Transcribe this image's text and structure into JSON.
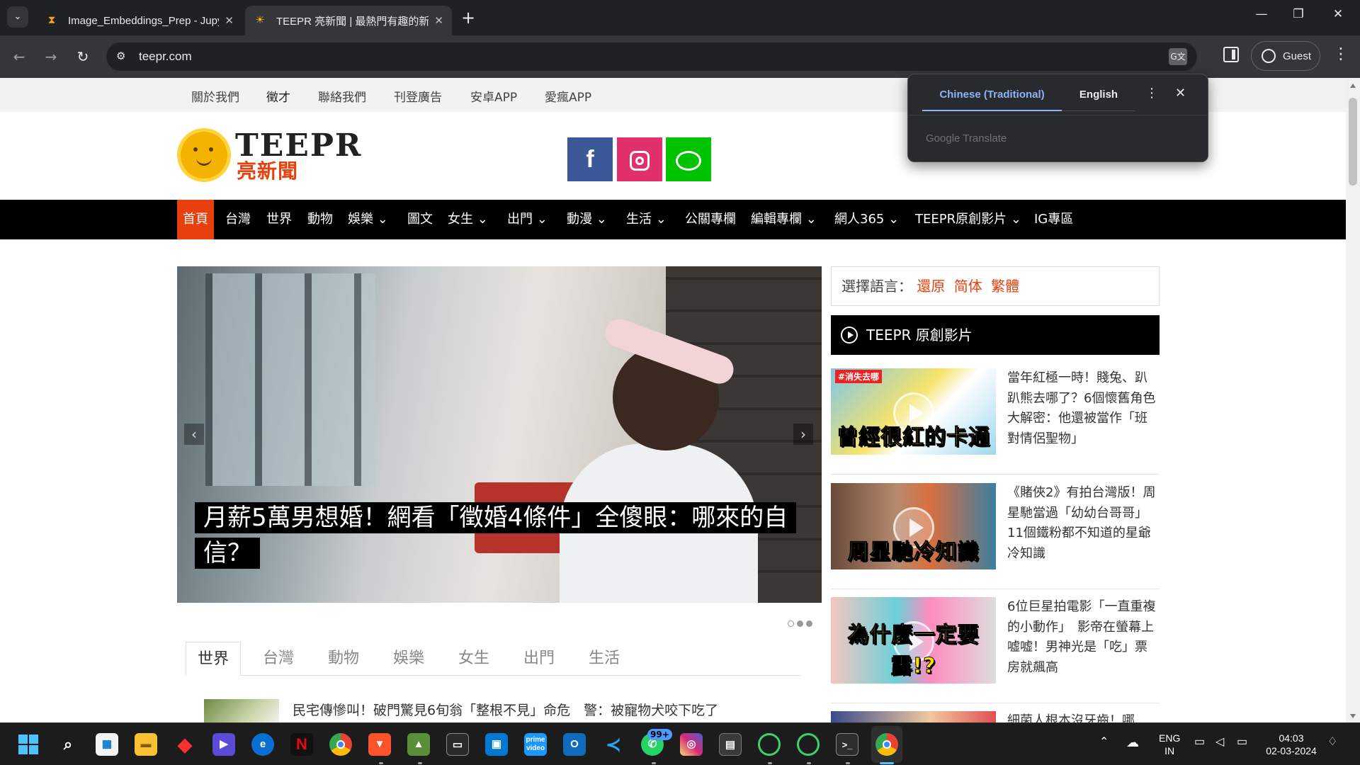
{
  "browser": {
    "tabs": [
      {
        "title": "Image_Embeddings_Prep - Jupyter",
        "active": false
      },
      {
        "title": "TEEPR 亮新聞 | 最熱門有趣的新聞",
        "active": true
      }
    ],
    "url": "teepr.com",
    "profile_label": "Guest"
  },
  "translate_popup": {
    "tab_active": "Chinese (Traditional)",
    "tab_other": "English",
    "brand": "Google Translate"
  },
  "site": {
    "top_links": [
      "關於我們",
      "徵才",
      "聯絡我們",
      "刊登廣告",
      "安卓APP",
      "愛瘋APP"
    ],
    "logo_text": "TEEPR",
    "logo_sub": "亮新聞",
    "social": {
      "facebook": "f"
    },
    "nav": [
      {
        "label": "首頁",
        "dropdown": false,
        "active": true
      },
      {
        "label": "台灣",
        "dropdown": false
      },
      {
        "label": "世界",
        "dropdown": false
      },
      {
        "label": "動物",
        "dropdown": false
      },
      {
        "label": "娛樂",
        "dropdown": true
      },
      {
        "label": "圖文",
        "dropdown": false
      },
      {
        "label": "女生",
        "dropdown": true
      },
      {
        "label": "出門",
        "dropdown": true
      },
      {
        "label": "動漫",
        "dropdown": true
      },
      {
        "label": "生活",
        "dropdown": true
      },
      {
        "label": "公關專欄",
        "dropdown": false
      },
      {
        "label": "編輯專欄",
        "dropdown": true
      },
      {
        "label": "網人365",
        "dropdown": true
      },
      {
        "label": "TEEPR原創影片",
        "dropdown": true
      },
      {
        "label": "IG專區",
        "dropdown": false
      }
    ],
    "slider": {
      "caption": "月薪5萬男想婚！網看「徵婚4條件」全傻眼：哪來的自信？",
      "slide_count": 3,
      "active_slide": 1
    },
    "category_tabs": [
      "世界",
      "台灣",
      "動物",
      "娛樂",
      "女生",
      "出門",
      "生活"
    ],
    "news_list": [
      {
        "title": "民宅傳慘叫！破門驚見6旬翁「整根不見」命危　警：被寵物犬咬下吃了"
      }
    ],
    "sidebar": {
      "lang_label": "選擇語言：",
      "lang_options": [
        "還原",
        "简体",
        "繁體"
      ],
      "video_heading": "TEEPR 原創影片",
      "videos": [
        {
          "title": "當年紅極一時！賤兔、趴趴熊去哪了？6個懷舊角色大解密：他還被當作「班對情侶聖物」",
          "thumb_text": "曾經很紅的卡通",
          "thumb_tag": "#消失去哪"
        },
        {
          "title": "《賭俠2》有拍台灣版！周星馳當過「幼幼台哥哥」　11個鐵粉都不知道的星爺冷知識",
          "thumb_text": "周星馳冷知識"
        },
        {
          "title": "6位巨星拍電影「一直重複的小動作」　影帝在螢幕上嘘嘘！男神光是「吃」票房就飆高",
          "thumb_text": "為什麼一定要露!?"
        },
        {
          "title": "細菌人根本沒牙齒！哪",
          "thumb_text": ""
        }
      ]
    }
  },
  "taskbar": {
    "language": "ENG",
    "region": "IN",
    "time": "04:03",
    "date": "02-03-2024",
    "whatsapp_badge": "99+"
  }
}
